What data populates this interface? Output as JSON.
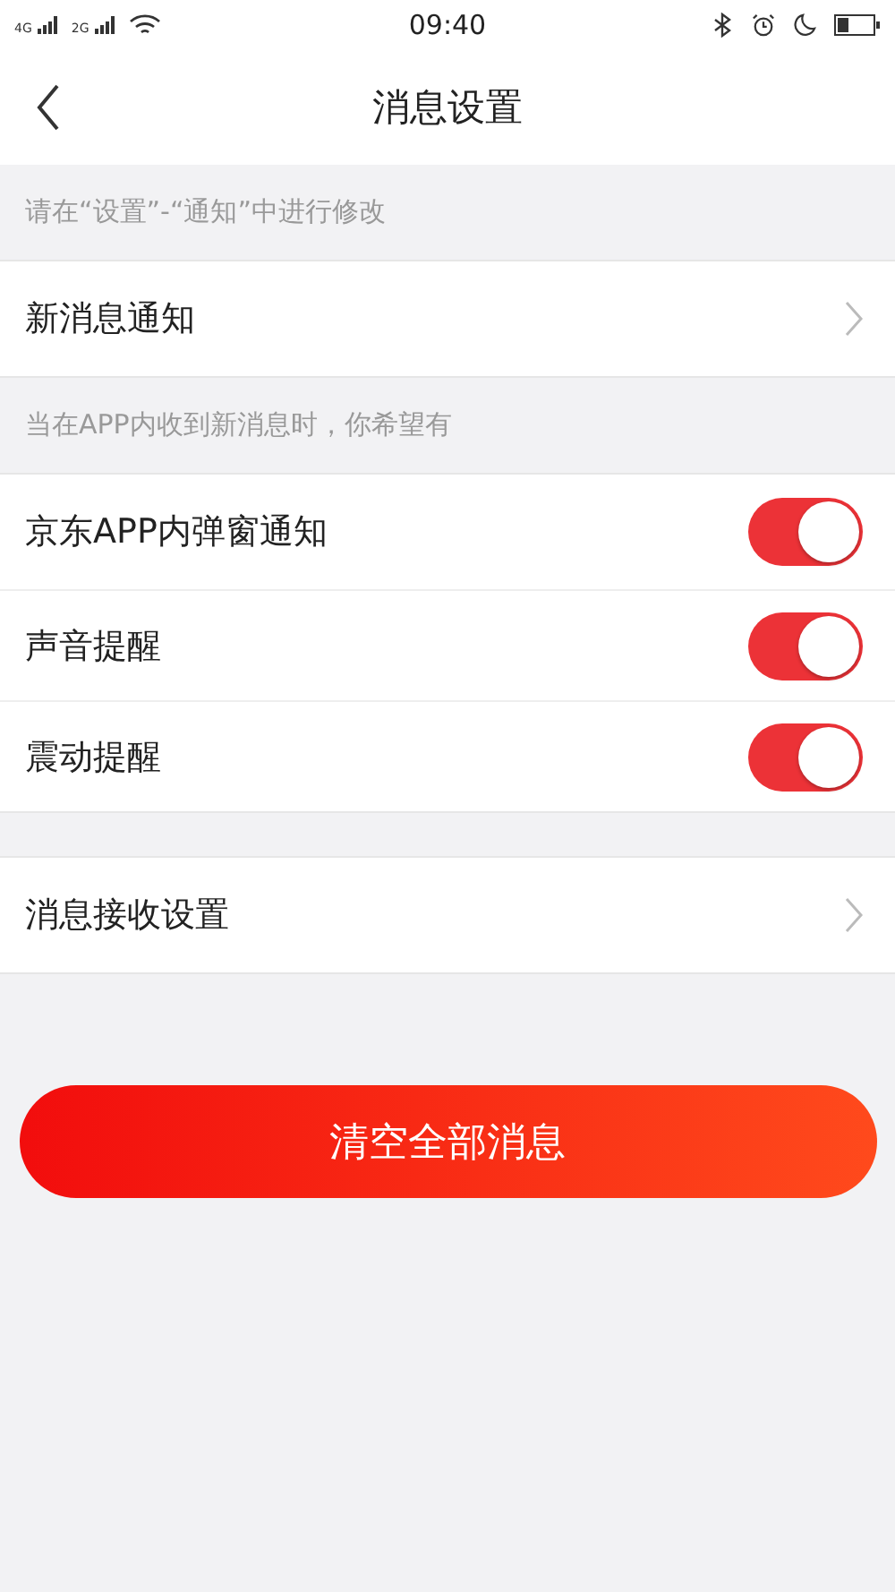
{
  "status_bar": {
    "networks": [
      "4G",
      "2G"
    ],
    "time": "09:40"
  },
  "header": {
    "title": "消息设置"
  },
  "sections": [
    {
      "hint": "请在“设置”-“通知”中进行修改",
      "rows": [
        {
          "kind": "link",
          "label": "新消息通知"
        }
      ]
    },
    {
      "hint": "当在APP内收到新消息时，你希望有",
      "rows": [
        {
          "kind": "toggle",
          "label": "京东APP内弹窗通知",
          "on": true
        },
        {
          "kind": "toggle",
          "label": "声音提醒",
          "on": true
        },
        {
          "kind": "toggle",
          "label": "震动提醒",
          "on": true
        }
      ]
    },
    {
      "rows": [
        {
          "kind": "link",
          "label": "消息接收设置"
        }
      ]
    }
  ],
  "clear_button": "清空全部消息"
}
